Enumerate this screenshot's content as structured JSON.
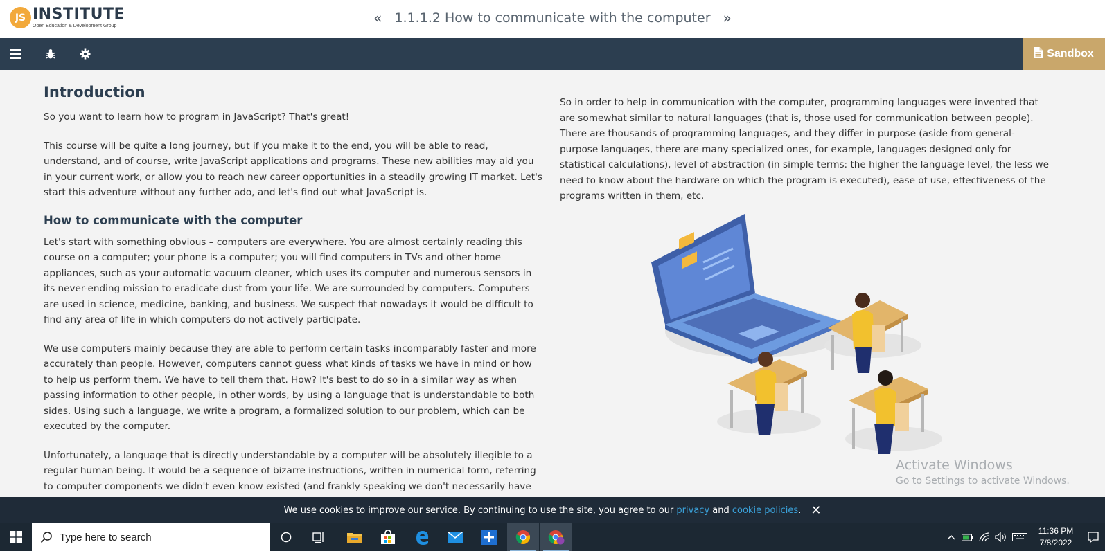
{
  "header": {
    "logo_badge": "JS",
    "logo_name": "INSTITUTE",
    "logo_sub": "Open Education & Development Group",
    "prev_arrow": "«",
    "lesson_title": "1.1.1.2 How to communicate with the computer",
    "next_arrow": "»"
  },
  "toolbar": {
    "icons": [
      "menu-icon",
      "bug-icon",
      "gear-icon"
    ],
    "sandbox_label": "Sandbox"
  },
  "content": {
    "intro_heading": "Introduction",
    "intro_p1": "So you want to learn how to program in JavaScript? That's great!",
    "intro_p2": "This course will be quite a long journey, but if you make it to the end, you will be able to read, understand, and of course, write JavaScript applications and programs. These new abilities may aid you in your current work, or allow you to reach new career opportunities in a steadily growing IT market. Let's start this adventure without any further ado, and let's find out what JavaScript is.",
    "section_heading": "How to communicate with the computer",
    "section_p1": "Let's start with something obvious – computers are everywhere. You are almost certainly reading this course on a computer; your phone is a computer; you will find computers in TVs and other home appliances, such as your automatic vacuum cleaner, which uses its computer and numerous sensors in its never-ending mission to eradicate dust from your life. We are surrounded by computers. Computers are used in science, medicine, banking, and business. We suspect that nowadays it would be difficult to find any area of life in which computers do not actively participate.",
    "section_p2": "We use computers mainly because they are able to perform certain tasks incomparably faster and more accurately than people. However, computers cannot guess what kinds of tasks we have in mind or how to help us perform them. We have to tell them that. How? It's best to do so in a similar way as when passing information to other people, in other words, by using a language that is understandable to both sides. Using such a language, we write a program, a formalized solution to our problem, which can be executed by the computer.",
    "section_p3": "Unfortunately, a language that is directly understandable by a computer will be absolutely illegible to a regular human being. It would be a sequence of bizarre instructions, written in numerical form, referring to computer components we didn't even know existed (and frankly speaking we don't necessarily have to know).",
    "right_p1": "So in order to help in communication with the computer, programming languages were invented that are somewhat similar to natural languages (that is, those used for communication between people). There are thousands of programming languages, and they differ in purpose (aside from general-purpose languages, there are many specialized ones, for example, languages designed only for statistical calculations), level of abstraction (in simple terms: the higher the language level, the less we need to know about the hardware on which the program is executed), ease of use, effectiveness of the programs written in them, etc."
  },
  "watermark": {
    "line1": "Activate Windows",
    "line2": "Go to Settings to activate Windows."
  },
  "cookie": {
    "text_before": "We use cookies to improve our service. By continuing to use the site, you agree to our ",
    "privacy_link": "privacy",
    "and_text": " and ",
    "cookie_link": "cookie policies",
    "text_after": ".",
    "close": "✕"
  },
  "taskbar": {
    "search_placeholder": "Type here to search",
    "apps": [
      "cortana-icon",
      "task-view-icon",
      "file-explorer-icon",
      "store-icon",
      "edge-icon",
      "mail-icon",
      "plus-app-icon",
      "chrome-icon",
      "chrome-profile-icon"
    ],
    "time": "11:36 PM",
    "date": "7/8/2022"
  },
  "colors": {
    "toolbar_bg": "#2c3e50",
    "sandbox_bg": "#c9a76b",
    "heading": "#2c3e50",
    "link": "#3aa0d8",
    "logo_badge": "#f2a93b"
  }
}
